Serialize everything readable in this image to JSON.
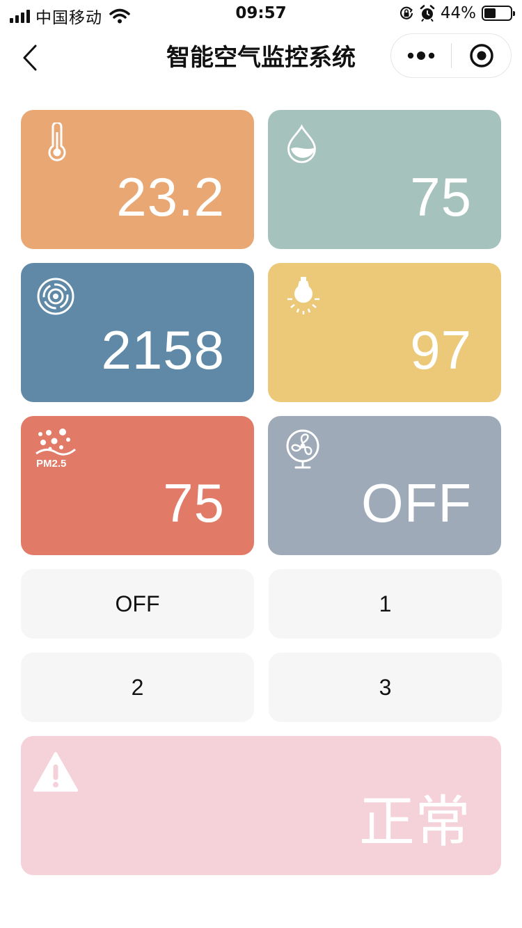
{
  "status_bar": {
    "carrier": "中国移动",
    "time": "09:57",
    "battery": "44%",
    "battery_level": 0.44
  },
  "nav": {
    "title": "智能空气监控系统"
  },
  "sensors": {
    "temperature": {
      "icon": "thermometer-icon",
      "value": "23.2",
      "color": "#e9a774"
    },
    "humidity": {
      "icon": "water-drop-icon",
      "value": "75",
      "color": "#a6c2bc"
    },
    "gas": {
      "icon": "smoke-detector-icon",
      "value": "2158",
      "color": "#5f89a6"
    },
    "light": {
      "icon": "light-bulb-icon",
      "value": "97",
      "color": "#ecc979"
    },
    "pm25": {
      "icon": "pm25-icon",
      "icon_text": "PM2.5",
      "value": "75",
      "color": "#e27a68"
    },
    "fan": {
      "icon": "fan-icon",
      "value": "OFF",
      "color": "#9eaab8"
    }
  },
  "fan_controls": [
    "OFF",
    "1",
    "2",
    "3"
  ],
  "alert": {
    "icon": "warning-icon",
    "status": "正常",
    "color": "#f5d1d9"
  }
}
